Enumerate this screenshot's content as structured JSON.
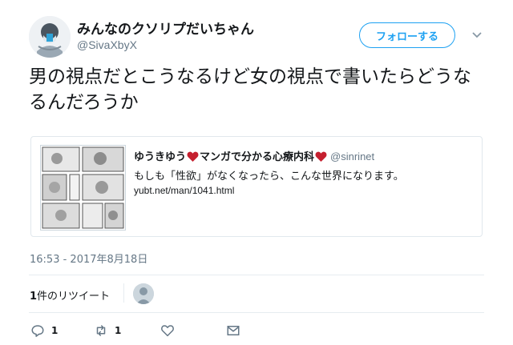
{
  "tweet": {
    "display_name": "みんなのクソリプだいちゃん",
    "handle": "@SivaXbyX",
    "follow_label": "フォローする",
    "text": "男の視点だとこうなるけど女の視点で書いたらどうなるんだろうか",
    "timestamp": "16:53 - 2017年8月18日"
  },
  "quote": {
    "name_part1": "ゆうきゆう",
    "name_part2": "マンガで分かる心療内科",
    "handle": "@sinrinet",
    "text": "もしも「性欲」がなくなったら、こんな世界になります。",
    "link": "yubt.net/man/1041.html",
    "heart_color": "#c5202f"
  },
  "stats": {
    "retweet_count": "1",
    "retweet_label": "件のリツイート"
  },
  "actions": {
    "reply_count": "1",
    "retweet_count": "1"
  },
  "colors": {
    "accent": "#1da1f2",
    "muted": "#657786",
    "text": "#14171a"
  }
}
